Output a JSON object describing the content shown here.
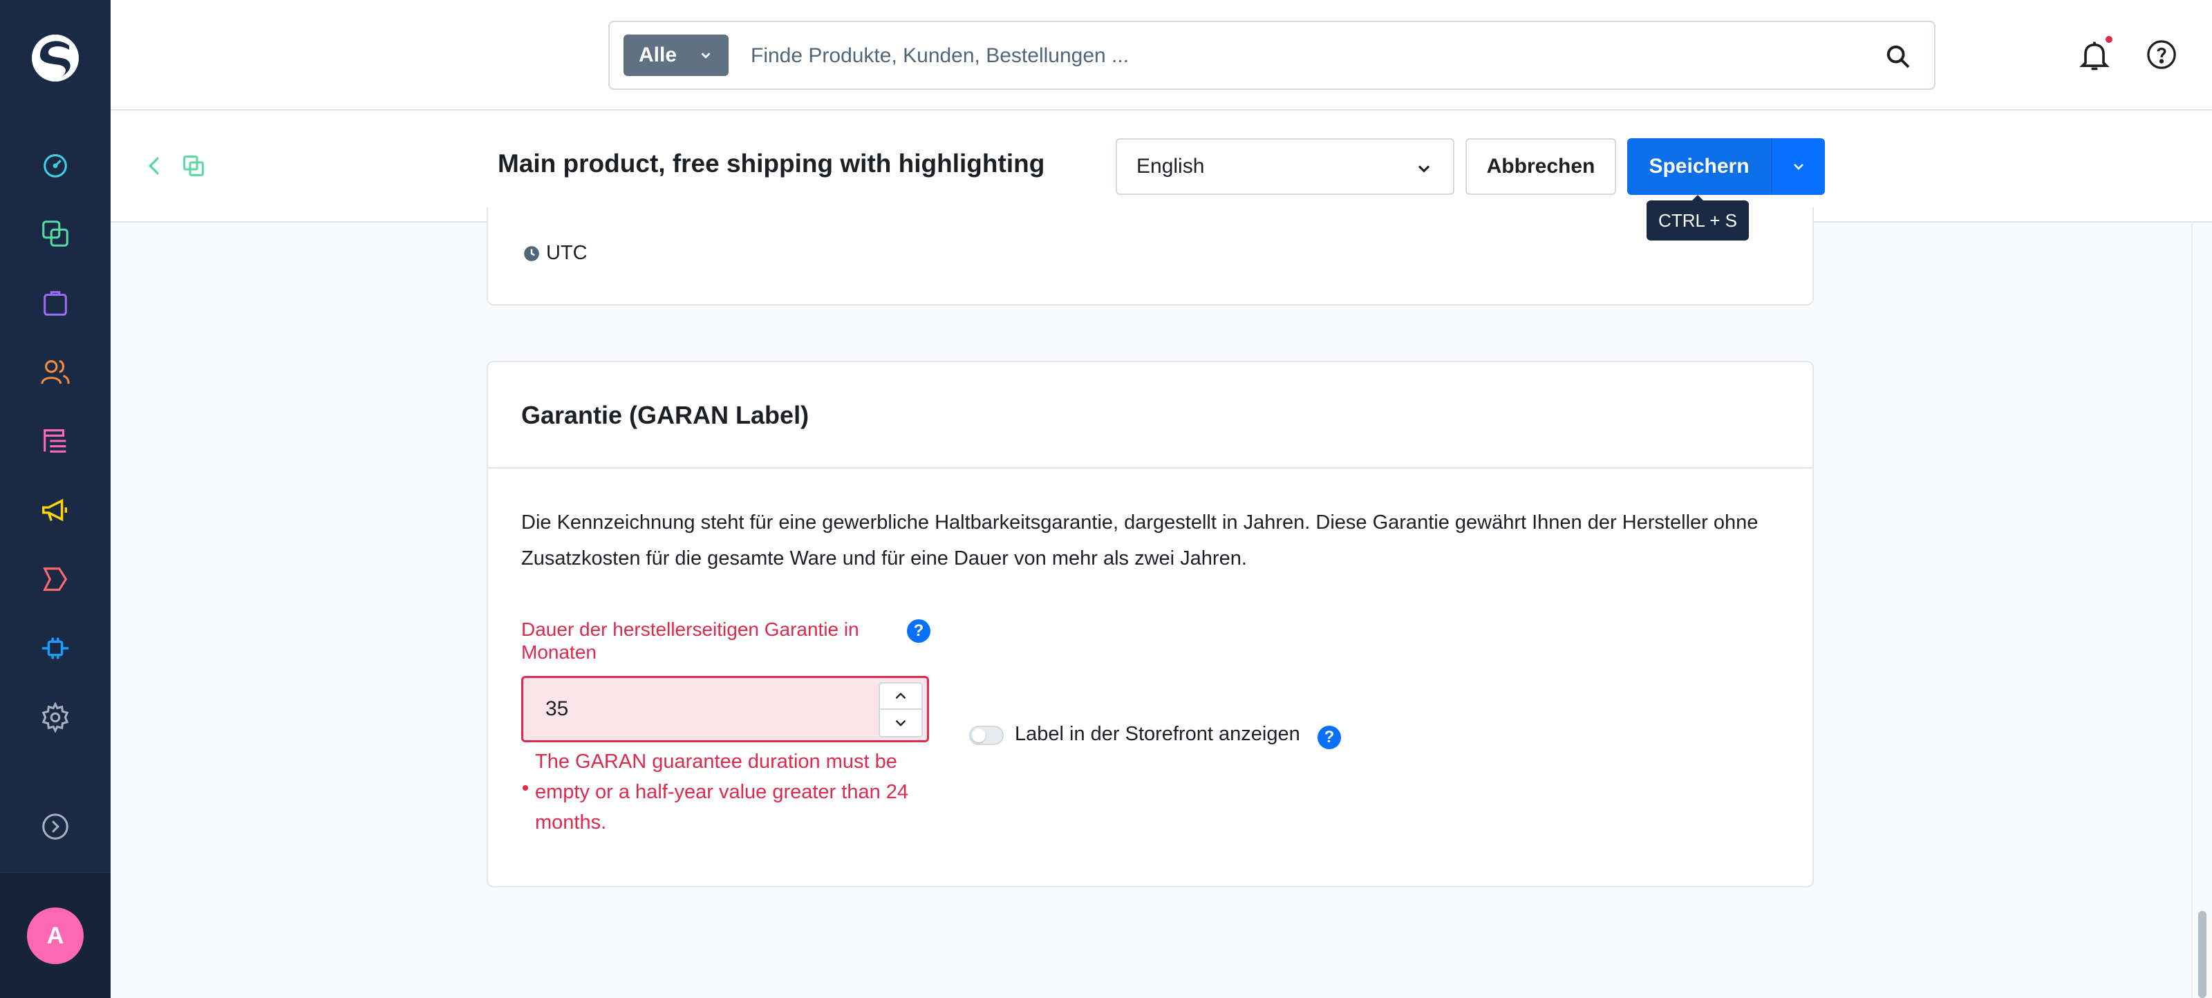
{
  "sidebar": {
    "items": [
      {
        "name": "dashboard",
        "color": "#3ccfe8"
      },
      {
        "name": "catalogues",
        "color": "#57d9a3"
      },
      {
        "name": "orders",
        "color": "#9b6bf2"
      },
      {
        "name": "customers",
        "color": "#f98b3e"
      },
      {
        "name": "content",
        "color": "#ff68b4"
      },
      {
        "name": "marketing",
        "color": "#ffd700"
      },
      {
        "name": "storefronts",
        "color": "#ff6b6b"
      },
      {
        "name": "extensions",
        "color": "#189eff"
      },
      {
        "name": "settings",
        "color": "#a6b1bd"
      }
    ],
    "avatar_initial": "A"
  },
  "search": {
    "type_label": "Alle",
    "placeholder": "Finde Produkte, Kunden, Bestellungen ..."
  },
  "smartbar": {
    "title": "Main product, free shipping with highlighting",
    "language": "English",
    "cancel_label": "Abbrechen",
    "save_label": "Speichern",
    "save_tooltip": "CTRL + S"
  },
  "timezone": {
    "label": "UTC"
  },
  "warranty": {
    "title": "Garantie (GARAN Label)",
    "description": "Die Kennzeichnung steht für eine gewerbliche Haltbarkeitsgarantie, dargestellt in Jahren. Diese Garantie gewährt Ihnen der Hersteller ohne Zusatzkosten für die gesamte Ware und für eine Dauer von mehr als zwei Jahren.",
    "duration_label": "Dauer der herstellerseitigen Garantie in Monaten",
    "duration_value": "35",
    "error_message": "The GARAN guarantee duration must be empty or a half-year value greater than 24 months.",
    "toggle_label": "Label in der Storefront anzeigen",
    "toggle_on": false,
    "help_symbol": "?"
  },
  "colors": {
    "sidebar_bg": "#1b2a44",
    "primary": "#0870ff",
    "error": "#de294c"
  }
}
